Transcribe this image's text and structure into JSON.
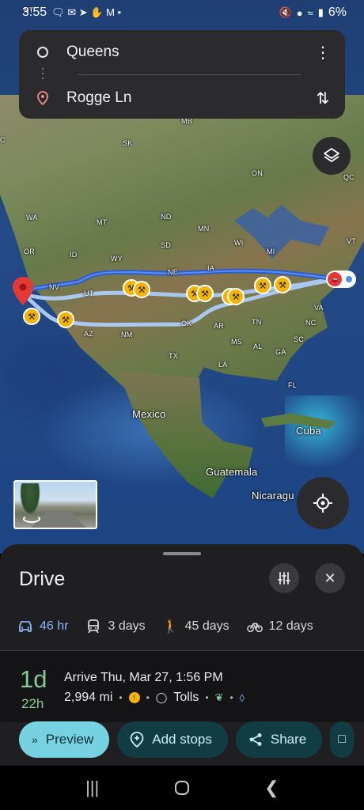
{
  "status_bar": {
    "time": "3:55",
    "battery": "6%",
    "corner_label": "NT"
  },
  "route_card": {
    "origin": "Queens",
    "destination": "Rogge Ln",
    "icons": {
      "origin": "origin-circle-icon",
      "destination": "location-pin-icon",
      "more": "more-vert-icon",
      "swap": "swap-vert-icon"
    }
  },
  "map": {
    "labels": [
      {
        "id": "mb",
        "text": "MB"
      },
      {
        "id": "sk",
        "text": "SK"
      },
      {
        "id": "on",
        "text": "ON"
      },
      {
        "id": "qc",
        "text": "QC"
      },
      {
        "id": "wa",
        "text": "WA"
      },
      {
        "id": "mt",
        "text": "MT"
      },
      {
        "id": "nd",
        "text": "ND"
      },
      {
        "id": "mn",
        "text": "MN"
      },
      {
        "id": "or",
        "text": "OR"
      },
      {
        "id": "id",
        "text": "ID"
      },
      {
        "id": "sd",
        "text": "SD"
      },
      {
        "id": "wi",
        "text": "WI"
      },
      {
        "id": "mi",
        "text": "MI"
      },
      {
        "id": "vt",
        "text": "VT"
      },
      {
        "id": "wy",
        "text": "WY"
      },
      {
        "id": "ne",
        "text": "NE"
      },
      {
        "id": "ia",
        "text": "IA"
      },
      {
        "id": "nv",
        "text": "NV"
      },
      {
        "id": "ut",
        "text": "UT"
      },
      {
        "id": "va",
        "text": "VA"
      },
      {
        "id": "az",
        "text": "AZ"
      },
      {
        "id": "nm",
        "text": "NM"
      },
      {
        "id": "ok",
        "text": "OK"
      },
      {
        "id": "ar",
        "text": "AR"
      },
      {
        "id": "tn",
        "text": "TN"
      },
      {
        "id": "nc",
        "text": "NC"
      },
      {
        "id": "sc",
        "text": "SC"
      },
      {
        "id": "ms",
        "text": "MS"
      },
      {
        "id": "al",
        "text": "AL"
      },
      {
        "id": "ga",
        "text": "GA"
      },
      {
        "id": "tx",
        "text": "TX"
      },
      {
        "id": "la",
        "text": "LA"
      },
      {
        "id": "fl",
        "text": "FL"
      },
      {
        "id": "c",
        "text": "C"
      },
      {
        "id": "mexico",
        "text": "Mexico"
      },
      {
        "id": "cuba",
        "text": "Cuba"
      },
      {
        "id": "guatemala",
        "text": "Guatemala"
      },
      {
        "id": "nicaragua",
        "text": "Nicaragu"
      }
    ],
    "colors": {
      "primary_route": "#3b6fe0",
      "alt_route": "#a9c8ef",
      "hazard": "#f5b400",
      "pin": "#e53935"
    }
  },
  "sheet": {
    "title": "Drive",
    "modes": [
      {
        "label": "46 hr",
        "icon": "car-icon",
        "active": true
      },
      {
        "label": "3 days",
        "icon": "train-icon",
        "active": false
      },
      {
        "label": "45 days",
        "icon": "walk-icon",
        "active": false
      },
      {
        "label": "12 days",
        "icon": "bike-icon",
        "active": false
      }
    ],
    "summary": {
      "duration_days": "1d",
      "duration_hours": "22h",
      "arrive": "Arrive Thu, Mar 27, 1:56 PM",
      "distance": "2,994 mi",
      "tolls": "Tolls"
    },
    "actions": [
      {
        "label": "Preview",
        "icon": "double-chevron-icon"
      },
      {
        "label": "Add stops",
        "icon": "add-location-icon"
      },
      {
        "label": "Share",
        "icon": "share-icon"
      }
    ]
  }
}
